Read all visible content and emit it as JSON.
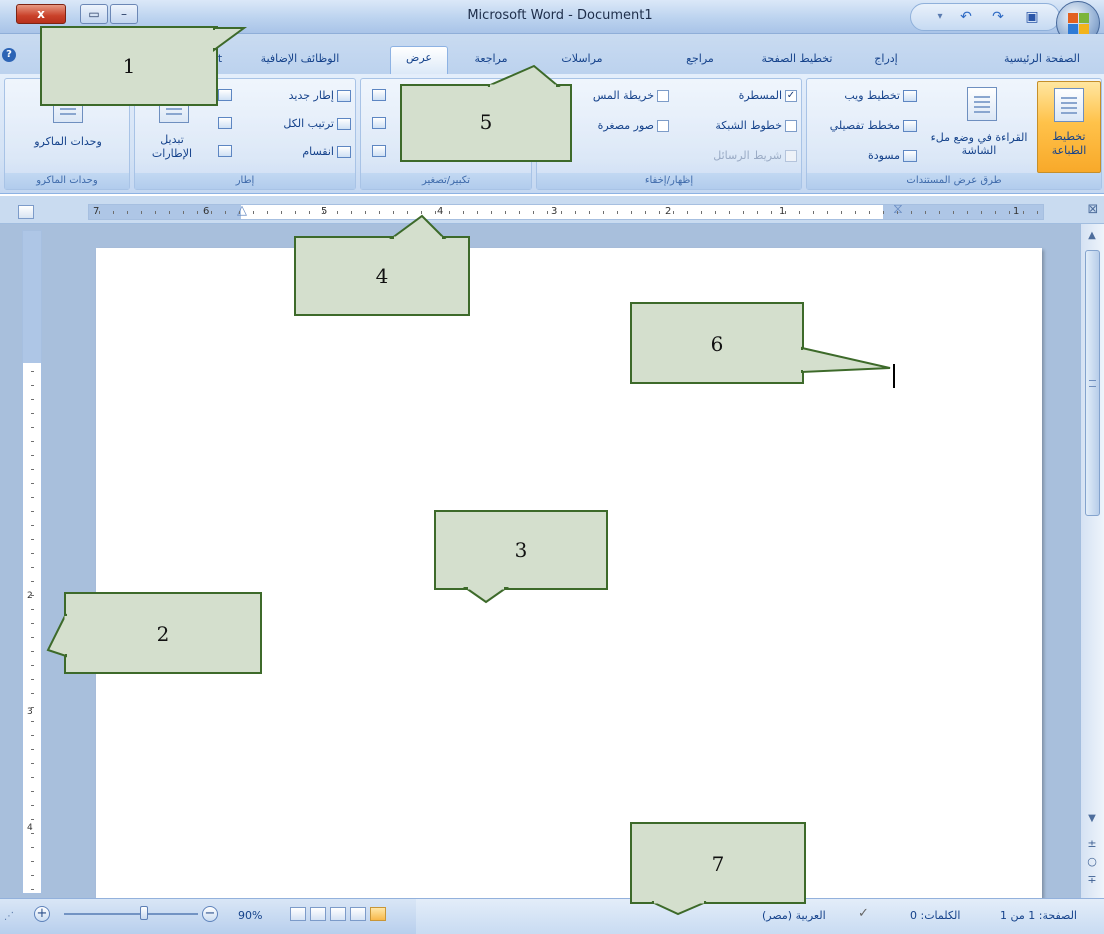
{
  "window": {
    "title": "Microsoft Word - Document1",
    "close_glyph": "x",
    "maximize_glyph": "▭",
    "minimize_glyph": "–"
  },
  "quick_access": {
    "undo_glyph": "↶",
    "redo_glyph": "↷",
    "save_glyph": "▣"
  },
  "tabs": [
    {
      "label": "الصفحة الرئيسية"
    },
    {
      "label": "إدراج"
    },
    {
      "label": "تخطيط الصفحة"
    },
    {
      "label": "مراجع"
    },
    {
      "label": "مراسلات"
    },
    {
      "label": "مراجعة"
    },
    {
      "label": "عرض",
      "active": true
    },
    {
      "label": "الوظائف الإضافية"
    },
    {
      "label": "t"
    }
  ],
  "ribbon": {
    "views_group": {
      "label": "طرق عرض المستندات",
      "print_layout": "تخطيط الطباعة",
      "full_screen_reading": "القراءة في وضع ملء الشاشة",
      "web_layout": "تخطيط ويب",
      "outline": "مخطط تفصيلي",
      "draft": "مسودة"
    },
    "show_hide_group": {
      "label": "إظهار/إخفاء",
      "ruler": "المسطرة",
      "gridlines": "خطوط الشبكة",
      "message_bar": "شريط الرسائل",
      "document_map": "خريطة المس",
      "thumbnails": "صور مصغرة",
      "ruler_checked": "✓"
    },
    "zoom_group": {
      "label": "تكبير/تصغير"
    },
    "window_group": {
      "label": "إطار",
      "new_window": "إطار جديد",
      "arrange_all": "ترتيب الكل",
      "split": "انقسام",
      "switch_windows": "تبديل الإطارات"
    },
    "macros_group": {
      "label": "وحدات الماكرو",
      "macros": "وحدات الماكرو"
    }
  },
  "ruler": {
    "numbers": [
      "7",
      "6",
      "5",
      "4",
      "3",
      "2",
      "1",
      "1"
    ]
  },
  "vruler_numbers": [
    "1",
    "2",
    "3",
    "4"
  ],
  "status_bar": {
    "zoom": "90%",
    "zoom_in": "+",
    "zoom_out": "−",
    "language": "العربية (مصر)",
    "words": "الكلمات: 0",
    "page": "الصفحة: 1 من 1"
  },
  "callouts": [
    "1",
    "2",
    "3",
    "4",
    "5",
    "6",
    "7"
  ],
  "colors": {
    "callout_fill": "#d4dfcd",
    "callout_border": "#3d6a2a",
    "ribbon_accent": "#15428b",
    "active_view": "#f8b84a"
  }
}
